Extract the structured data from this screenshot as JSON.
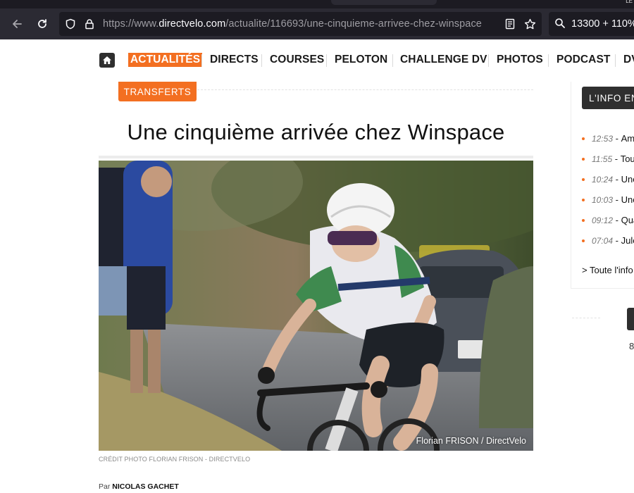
{
  "browser": {
    "corner_text": "LE",
    "url_prefix": "https://www.",
    "url_host": "directvelo.com",
    "url_path": "/actualite/116693/une-cinquieme-arrivee-chez-winspace",
    "search_text": "13300 + 110%",
    "icons": [
      "back-arrow-icon",
      "reload-icon",
      "shield-icon",
      "lock-icon",
      "reader-view-icon",
      "star-icon",
      "search-icon"
    ]
  },
  "nav": {
    "items": [
      "ACTUALITÉS",
      "DIRECTS",
      "COURSES",
      "PELOTON",
      "CHALLENGE DV",
      "PHOTOS",
      "PODCAST",
      "DV"
    ],
    "active_index": 0,
    "accent": "#f36f21"
  },
  "article": {
    "category": "TRANSFERTS",
    "title": "Une cinquième arrivée chez Winspace",
    "watermark_name": "Florian FRISON",
    "watermark_sep": "/",
    "watermark_site": "DirectVelo",
    "photo_credit": "CRÉDIT PHOTO FLORIAN FRISON - DIRECTVELO",
    "byline_prefix": "Par",
    "byline_author": "NICOLAS GACHET"
  },
  "sidebar": {
    "header": "L'INFO EN",
    "items": [
      {
        "time": "12:53",
        "title": "Am"
      },
      {
        "time": "11:55",
        "title": "Tou"
      },
      {
        "time": "10:24",
        "title": "Une"
      },
      {
        "time": "10:03",
        "title": "Une"
      },
      {
        "time": "09:12",
        "title": "Qua"
      },
      {
        "time": "07:04",
        "title": "Jule"
      }
    ],
    "all_link": "> Toute l'info",
    "number": "8"
  }
}
